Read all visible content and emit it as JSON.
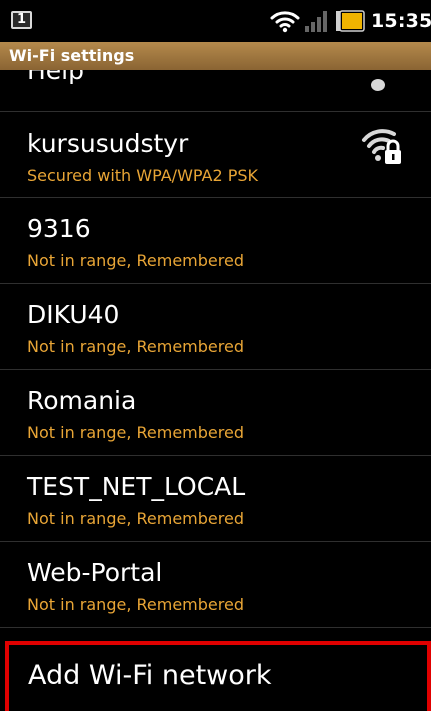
{
  "status_bar": {
    "notification_badge": "1",
    "time": "15:35",
    "icons": [
      "wifi-icon",
      "signal-icon",
      "battery-icon"
    ],
    "battery_color": "#f0b400"
  },
  "title_bar": {
    "title": "Wi-Fi settings",
    "color": "#a07640"
  },
  "list": {
    "partial_top_label": "Help",
    "networks": [
      {
        "name": "kursusudstyr",
        "status": "Secured with WPA/WPA2 PSK",
        "icon": "wifi-lock-icon"
      },
      {
        "name": "9316",
        "status": "Not in range, Remembered"
      },
      {
        "name": "DIKU40",
        "status": "Not in range, Remembered"
      },
      {
        "name": "Romania",
        "status": "Not in range, Remembered"
      },
      {
        "name": "TEST_NET_LOCAL",
        "status": "Not in range, Remembered"
      },
      {
        "name": "Web-Portal",
        "status": "Not in range, Remembered"
      }
    ],
    "add_network_label": "Add Wi-Fi network",
    "status_color": "#e8a536",
    "highlight_color": "#e00000"
  }
}
